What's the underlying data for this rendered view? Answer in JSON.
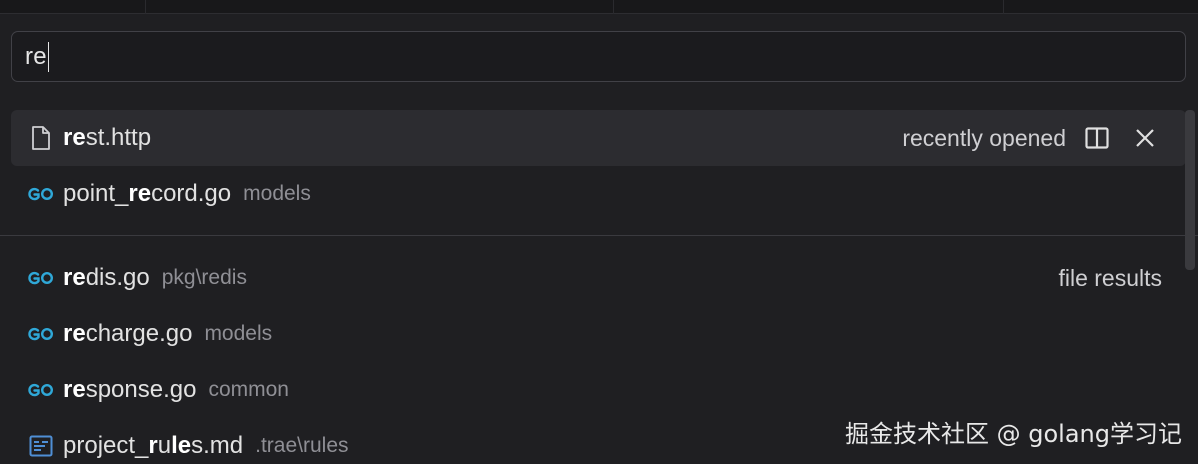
{
  "search": {
    "value": "re"
  },
  "results": [
    {
      "match": "re",
      "name_rest": "st.http",
      "path": "",
      "icon": "file-icon",
      "right_label": "recently opened",
      "selected": true
    },
    {
      "prefix": "point_",
      "match": "re",
      "name_rest": "cord.go",
      "path": "models",
      "icon": "go-icon"
    },
    {
      "match": "re",
      "name_rest": "dis.go",
      "path": "pkg\\redis",
      "icon": "go-icon",
      "right_label": "file results"
    },
    {
      "match": "re",
      "name_rest": "charge.go",
      "path": "models",
      "icon": "go-icon"
    },
    {
      "match": "re",
      "name_rest": "sponse.go",
      "path": "common",
      "icon": "go-icon"
    },
    {
      "prefix": "project_",
      "match": "r",
      "mid": "u",
      "match2": "le",
      "name_rest": "s.md",
      "path": ".trae\\rules",
      "icon": "markdown-icon"
    }
  ],
  "watermark": "掘金技术社区 @ golang学习记",
  "colors": {
    "go_icon": "#2fa8d8",
    "markdown_icon": "#4f8fd6",
    "selected_bg": "#2c2c30"
  }
}
